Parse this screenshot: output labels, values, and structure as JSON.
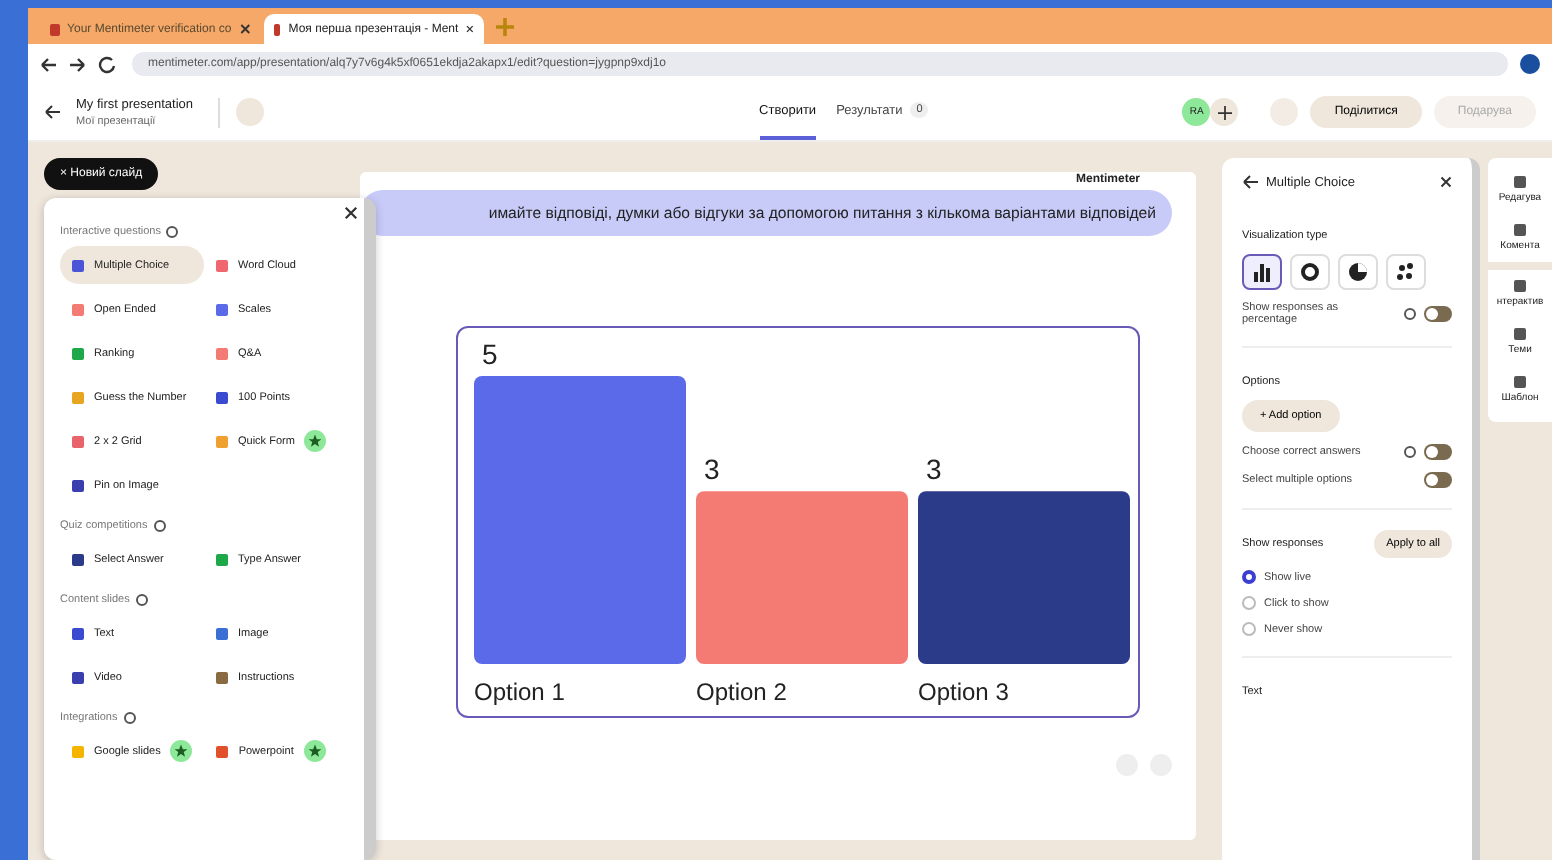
{
  "browser": {
    "tabs": [
      {
        "label": "Your Mentimeter verification co",
        "selected": false
      },
      {
        "label": "Моя перша презентація - Ment",
        "selected": true
      }
    ],
    "url": "mentimeter.com/app/presentation/alq7y7v6g4k5xf0651ekdja2akapx1/edit?question=jygpnp9xdj1o"
  },
  "header": {
    "title": "My first presentation",
    "breadcrumb": "Мої презентації",
    "tabs": [
      {
        "label": "Створити",
        "selected": true
      },
      {
        "label": "Результати",
        "selected": false,
        "count": "0"
      }
    ],
    "avatar": "RA",
    "share": "Поділитися",
    "gift": "Подарува"
  },
  "new_slide": "Новий слайд",
  "new_slide_icon": "×",
  "slide": {
    "question": "имайте відповіді, думки або відгуки за допомогою питання з кількома варіантами відповідей",
    "logo": "Mentimeter",
    "chart_data": {
      "type": "bar",
      "categories": [
        "Option 1",
        "Option 2",
        "Option 3"
      ],
      "values": [
        5,
        3,
        3
      ],
      "data_labels": true
    }
  },
  "slide_types": [
    {
      "title": "Interactive questions",
      "items": [
        {
          "label": "Multiple Choice",
          "color": "#4a55d8",
          "selected": true,
          "badge": false
        },
        {
          "label": "Word Cloud",
          "color": "#f0666e",
          "selected": false,
          "badge": false
        },
        {
          "label": "Open Ended",
          "color": "#f47b73",
          "selected": false,
          "badge": false
        },
        {
          "label": "Scales",
          "color": "#5b6ae8",
          "selected": false,
          "badge": false
        },
        {
          "label": "Ranking",
          "color": "#1fa84a",
          "selected": false,
          "badge": false
        },
        {
          "label": "Q&A",
          "color": "#f47b73",
          "selected": false,
          "badge": false
        },
        {
          "label": "Guess the Number",
          "color": "#e8a520",
          "selected": false,
          "badge": false
        },
        {
          "label": "100 Points",
          "color": "#3a4bd0",
          "selected": false,
          "badge": false
        },
        {
          "label": "2 x 2 Grid",
          "color": "#e8646a",
          "selected": false,
          "badge": false
        },
        {
          "label": "Quick Form",
          "color": "#f0a030",
          "selected": false,
          "badge": true
        },
        {
          "label": "Pin on Image",
          "color": "#3a3fb0",
          "selected": false,
          "badge": false
        }
      ]
    },
    {
      "title": "Quiz competitions",
      "items": [
        {
          "label": "Select Answer",
          "color": "#2c3a8a",
          "selected": false,
          "badge": false
        },
        {
          "label": "Type Answer",
          "color": "#1fa84a",
          "selected": false,
          "badge": false
        }
      ]
    },
    {
      "title": "Content slides",
      "items": [
        {
          "label": "Text",
          "color": "#3a4bd0",
          "selected": false,
          "badge": false
        },
        {
          "label": "Image",
          "color": "#3a6fd6",
          "selected": false,
          "badge": false
        },
        {
          "label": "Video",
          "color": "#3a3fb0",
          "selected": false,
          "badge": false
        },
        {
          "label": "Instructions",
          "color": "#8a6a40",
          "selected": false,
          "badge": false
        }
      ]
    },
    {
      "title": "Integrations",
      "items": [
        {
          "label": "Google slides",
          "color": "#f5b400",
          "selected": false,
          "badge": true
        },
        {
          "label": "Powerpoint",
          "color": "#e0502a",
          "selected": false,
          "badge": true
        }
      ]
    }
  ],
  "settings": {
    "title": "Multiple Choice",
    "viz_label": "Visualization type",
    "viz": [
      {
        "kind": "bars",
        "selected": true
      },
      {
        "kind": "donut",
        "selected": false
      },
      {
        "kind": "pie",
        "selected": false
      },
      {
        "kind": "dots",
        "selected": false
      }
    ],
    "percentage": {
      "label": "Show responses as percentage",
      "on": false
    },
    "options_label": "Options",
    "add_option": "+ Add option",
    "toggles": [
      {
        "label": "Choose correct answers",
        "help": true,
        "on": false
      },
      {
        "label": "Select multiple options",
        "help": false,
        "on": false
      }
    ],
    "show_label": "Show responses",
    "apply": "Apply to all",
    "radios": [
      {
        "label": "Show live",
        "selected": true
      },
      {
        "label": "Click to show",
        "selected": false
      },
      {
        "label": "Never show",
        "selected": false
      }
    ],
    "text_label": "Text"
  },
  "toolbar": [
    {
      "label": "Редагува"
    },
    {
      "label": "Комента"
    },
    {
      "label": "нтерактив"
    },
    {
      "label": "Теми"
    },
    {
      "label": "Шаблон"
    }
  ]
}
